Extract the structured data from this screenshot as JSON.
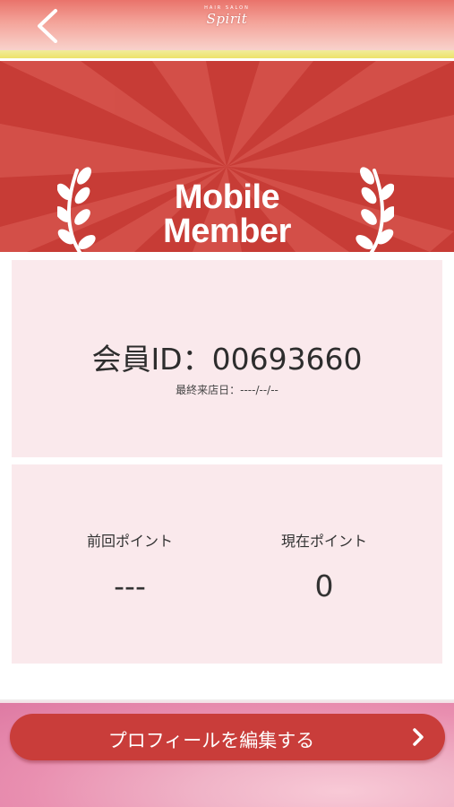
{
  "header": {
    "logo_text": "Spirit",
    "logo_subtext": "HAIR SALON",
    "back_icon": "chevron-left-icon"
  },
  "banner": {
    "title_line1": "Mobile",
    "title_line2": "Member",
    "background_color": "#c73c36",
    "decoration_icon": "laurel-icon"
  },
  "member": {
    "id_text": "会員ID：00693660",
    "last_visit_text": "最終来店日：----/--/--"
  },
  "points": {
    "previous_label": "前回ポイント",
    "previous_value": "---",
    "current_label": "現在ポイント",
    "current_value": "0"
  },
  "actions": {
    "edit_profile_label": "プロフィールを編集する",
    "edit_profile_icon": "chevron-right-icon",
    "accent_color": "#c93d3a"
  }
}
